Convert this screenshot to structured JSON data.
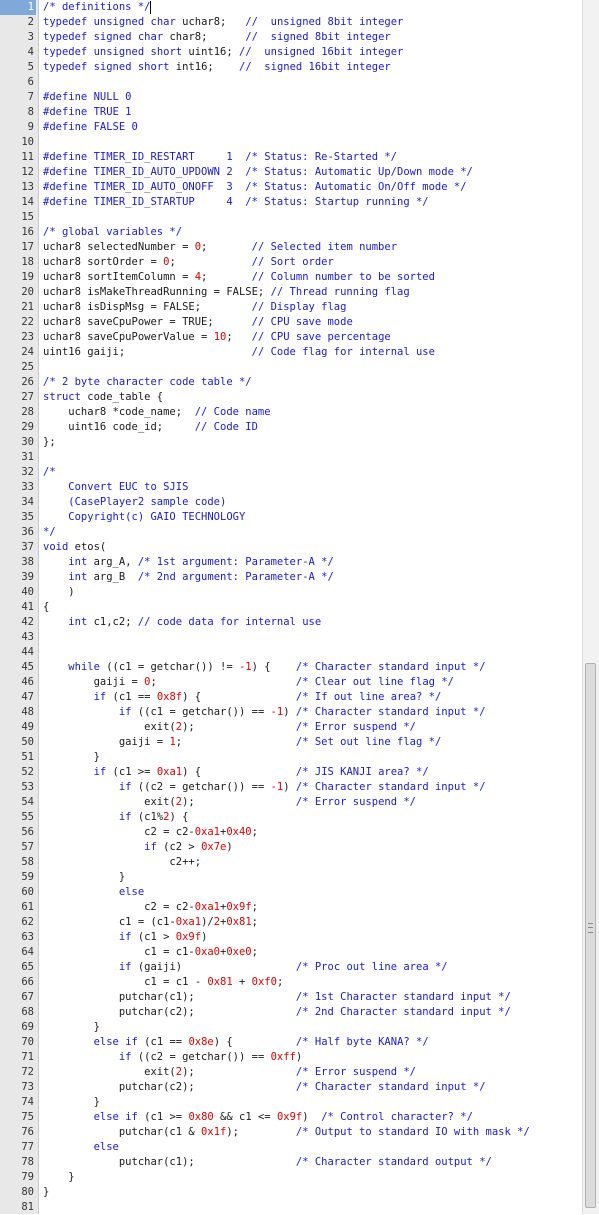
{
  "editor": {
    "current_line": 1,
    "colors": {
      "keyword": "#1a1ad6",
      "comment": "#1a1ad6",
      "number": "#e00000",
      "preprocessor": "#1a1ad6",
      "text": "#1a1a1a",
      "gutter_bg": "#e8e8e8",
      "current_line_marker": "#7fa9d6"
    },
    "lines": [
      {
        "n": "1",
        "t": "/* definitions */"
      },
      {
        "n": "2",
        "t": "typedef unsigned char uchar8;   //  unsigned 8bit integer"
      },
      {
        "n": "3",
        "t": "typedef signed char char8;      //  signed 8bit integer"
      },
      {
        "n": "4",
        "t": "typedef unsigned short uint16; //  unsigned 16bit integer"
      },
      {
        "n": "5",
        "t": "typedef signed short int16;    //  signed 16bit integer"
      },
      {
        "n": "6",
        "t": ""
      },
      {
        "n": "7",
        "t": "#define NULL 0"
      },
      {
        "n": "8",
        "t": "#define TRUE 1"
      },
      {
        "n": "9",
        "t": "#define FALSE 0"
      },
      {
        "n": "10",
        "t": ""
      },
      {
        "n": "11",
        "t": "#define TIMER_ID_RESTART     1  /* Status: Re-Started */"
      },
      {
        "n": "12",
        "t": "#define TIMER_ID_AUTO_UPDOWN 2  /* Status: Automatic Up/Down mode */"
      },
      {
        "n": "13",
        "t": "#define TIMER_ID_AUTO_ONOFF  3  /* Status: Automatic On/Off mode */"
      },
      {
        "n": "14",
        "t": "#define TIMER_ID_STARTUP     4  /* Status: Startup running */"
      },
      {
        "n": "15",
        "t": ""
      },
      {
        "n": "16",
        "t": "/* global variables */"
      },
      {
        "n": "17",
        "t": "uchar8 selectedNumber = 0;       // Selected item number"
      },
      {
        "n": "18",
        "t": "uchar8 sortOrder = 0;            // Sort order"
      },
      {
        "n": "19",
        "t": "uchar8 sortItemColumn = 4;       // Column number to be sorted"
      },
      {
        "n": "20",
        "t": "uchar8 isMakeThreadRunning = FALSE; // Thread running flag"
      },
      {
        "n": "21",
        "t": "uchar8 isDispMsg = FALSE;        // Display flag"
      },
      {
        "n": "22",
        "t": "uchar8 saveCpuPower = TRUE;      // CPU save mode"
      },
      {
        "n": "23",
        "t": "uchar8 saveCpuPowerValue = 10;   // CPU save percentage"
      },
      {
        "n": "24",
        "t": "uint16 gaiji;                    // Code flag for internal use"
      },
      {
        "n": "25",
        "t": ""
      },
      {
        "n": "26",
        "t": "/* 2 byte character code table */"
      },
      {
        "n": "27",
        "t": "struct code_table {"
      },
      {
        "n": "28",
        "t": "    uchar8 *code_name;  // Code name"
      },
      {
        "n": "29",
        "t": "    uint16 code_id;     // Code ID"
      },
      {
        "n": "30",
        "t": "};"
      },
      {
        "n": "31",
        "t": ""
      },
      {
        "n": "32",
        "t": "/*"
      },
      {
        "n": "33",
        "t": "    Convert EUC to SJIS"
      },
      {
        "n": "34",
        "t": "    (CasePlayer2 sample code)"
      },
      {
        "n": "35",
        "t": "    Copyright(c) GAIO TECHNOLOGY"
      },
      {
        "n": "36",
        "t": "*/"
      },
      {
        "n": "37",
        "t": "void etos("
      },
      {
        "n": "38",
        "t": "    int arg_A, /* 1st argument: Parameter-A */"
      },
      {
        "n": "39",
        "t": "    int arg_B  /* 2nd argument: Parameter-A */"
      },
      {
        "n": "40",
        "t": "    )"
      },
      {
        "n": "41",
        "t": "{"
      },
      {
        "n": "42",
        "t": "    int c1,c2; // code data for internal use"
      },
      {
        "n": "43",
        "t": ""
      },
      {
        "n": "44",
        "t": ""
      },
      {
        "n": "45",
        "t": "    while ((c1 = getchar()) != -1) {    /* Character standard input */"
      },
      {
        "n": "46",
        "t": "        gaiji = 0;                      /* Clear out line flag */"
      },
      {
        "n": "47",
        "t": "        if (c1 == 0x8f) {               /* If out line area? */"
      },
      {
        "n": "48",
        "t": "            if ((c1 = getchar()) == -1) /* Character standard input */"
      },
      {
        "n": "49",
        "t": "                exit(2);                /* Error suspend */"
      },
      {
        "n": "50",
        "t": "            gaiji = 1;                  /* Set out line flag */"
      },
      {
        "n": "51",
        "t": "        }"
      },
      {
        "n": "52",
        "t": "        if (c1 >= 0xa1) {               /* JIS KANJI area? */"
      },
      {
        "n": "53",
        "t": "            if ((c2 = getchar()) == -1) /* Character standard input */"
      },
      {
        "n": "54",
        "t": "                exit(2);                /* Error suspend */"
      },
      {
        "n": "55",
        "t": "            if (c1%2) {"
      },
      {
        "n": "56",
        "t": "                c2 = c2-0xa1+0x40;"
      },
      {
        "n": "57",
        "t": "                if (c2 > 0x7e)"
      },
      {
        "n": "58",
        "t": "                    c2++;"
      },
      {
        "n": "59",
        "t": "            }"
      },
      {
        "n": "60",
        "t": "            else"
      },
      {
        "n": "61",
        "t": "                c2 = c2-0xa1+0x9f;"
      },
      {
        "n": "62",
        "t": "            c1 = (c1-0xa1)/2+0x81;"
      },
      {
        "n": "63",
        "t": "            if (c1 > 0x9f)"
      },
      {
        "n": "64",
        "t": "                c1 = c1-0xa0+0xe0;"
      },
      {
        "n": "65",
        "t": "            if (gaiji)                  /* Proc out line area */"
      },
      {
        "n": "66",
        "t": "                c1 = c1 - 0x81 + 0xf0;"
      },
      {
        "n": "67",
        "t": "            putchar(c1);                /* 1st Character standard input */"
      },
      {
        "n": "68",
        "t": "            putchar(c2);                /* 2nd Character standard input */"
      },
      {
        "n": "69",
        "t": "        }"
      },
      {
        "n": "70",
        "t": "        else if (c1 == 0x8e) {          /* Half byte KANA? */"
      },
      {
        "n": "71",
        "t": "            if ((c2 = getchar()) == 0xff)"
      },
      {
        "n": "72",
        "t": "                exit(2);                /* Error suspend */"
      },
      {
        "n": "73",
        "t": "            putchar(c2);                /* Character standard input */"
      },
      {
        "n": "74",
        "t": "        }"
      },
      {
        "n": "75",
        "t": "        else if (c1 >= 0x80 && c1 <= 0x9f)  /* Control character? */"
      },
      {
        "n": "76",
        "t": "            putchar(c1 & 0x1f);         /* Output to standard IO with mask */"
      },
      {
        "n": "77",
        "t": "        else"
      },
      {
        "n": "78",
        "t": "            putchar(c1);                /* Character standard output */"
      },
      {
        "n": "79",
        "t": "    }"
      },
      {
        "n": "80",
        "t": "}"
      },
      {
        "n": "81",
        "t": ""
      }
    ]
  }
}
